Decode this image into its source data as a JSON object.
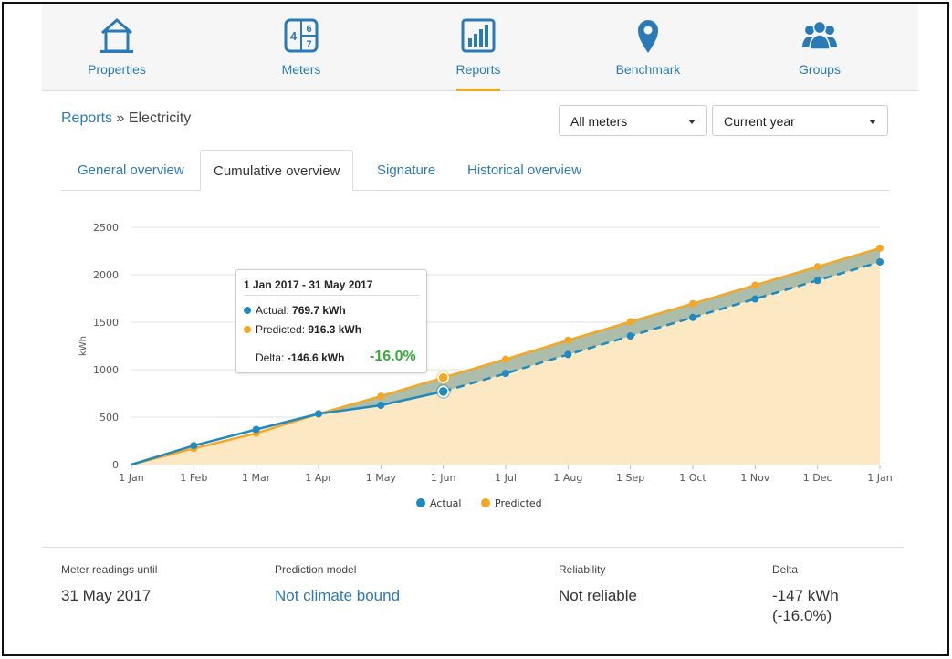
{
  "nav": {
    "items": [
      {
        "label": "Properties",
        "icon": "house-icon"
      },
      {
        "label": "Meters",
        "icon": "meter-digits-icon"
      },
      {
        "label": "Reports",
        "icon": "bar-chart-icon",
        "active": true
      },
      {
        "label": "Benchmark",
        "icon": "map-pin-icon"
      },
      {
        "label": "Groups",
        "icon": "users-icon"
      }
    ],
    "meter_digits": [
      "4",
      "6",
      "7"
    ]
  },
  "breadcrumb": {
    "parent": "Reports",
    "separator": " » ",
    "current": "Electricity"
  },
  "filters": {
    "meter_select": "All meters",
    "period_select": "Current year"
  },
  "tabs": [
    {
      "label": "General overview"
    },
    {
      "label": "Cumulative overview",
      "active": true
    },
    {
      "label": "Signature"
    },
    {
      "label": "Historical overview"
    }
  ],
  "chart_data": {
    "type": "area",
    "ylabel": "kWh",
    "ylim": [
      0,
      2500
    ],
    "yticks": [
      "0",
      "500",
      "1000",
      "1500",
      "2000",
      "2500"
    ],
    "categories": [
      "1 Jan",
      "1 Feb",
      "1 Mar",
      "1 Apr",
      "1 May",
      "1 Jun",
      "1 Jul",
      "1 Aug",
      "1 Sep",
      "1 Oct",
      "1 Nov",
      "1 Dec",
      "1 Jan"
    ],
    "series": [
      {
        "name": "Actual",
        "color": "#1f8ac0",
        "values": [
          0,
          200,
          370,
          535,
          625,
          770,
          960,
          1160,
          1355,
          1550,
          1745,
          1940,
          2135
        ],
        "measured_until_index": 5
      },
      {
        "name": "Predicted",
        "color": "#f5a623",
        "values": [
          0,
          170,
          330,
          535,
          720,
          916,
          1110,
          1310,
          1505,
          1695,
          1890,
          2085,
          2280
        ]
      }
    ],
    "grid": true,
    "legend": "bottom"
  },
  "tooltip": {
    "title": "1 Jan 2017 - 31 May 2017",
    "actual_label": "Actual:",
    "actual_value": "769.7 kWh",
    "predicted_label": "Predicted:",
    "predicted_value": "916.3 kWh",
    "delta_label": "Delta:",
    "delta_value": "-146.6 kWh",
    "delta_pct": "-16.0%",
    "pct_color": "#3da83d"
  },
  "legend": {
    "actual": "Actual",
    "predicted": "Predicted"
  },
  "stats": {
    "readings": {
      "label": "Meter readings until",
      "value": "31 May 2017"
    },
    "model": {
      "label": "Prediction model",
      "value": "Not climate bound"
    },
    "reliability": {
      "label": "Reliability",
      "value": "Not reliable"
    },
    "delta": {
      "label": "Delta",
      "value": "-147 kWh",
      "value2": "(-16.0%)"
    }
  },
  "colors": {
    "accent": "#2b7ab8",
    "actual": "#1f8ac0",
    "predicted": "#f5a623",
    "area": "#fde8c4",
    "delta_band": "#9db5a6"
  }
}
